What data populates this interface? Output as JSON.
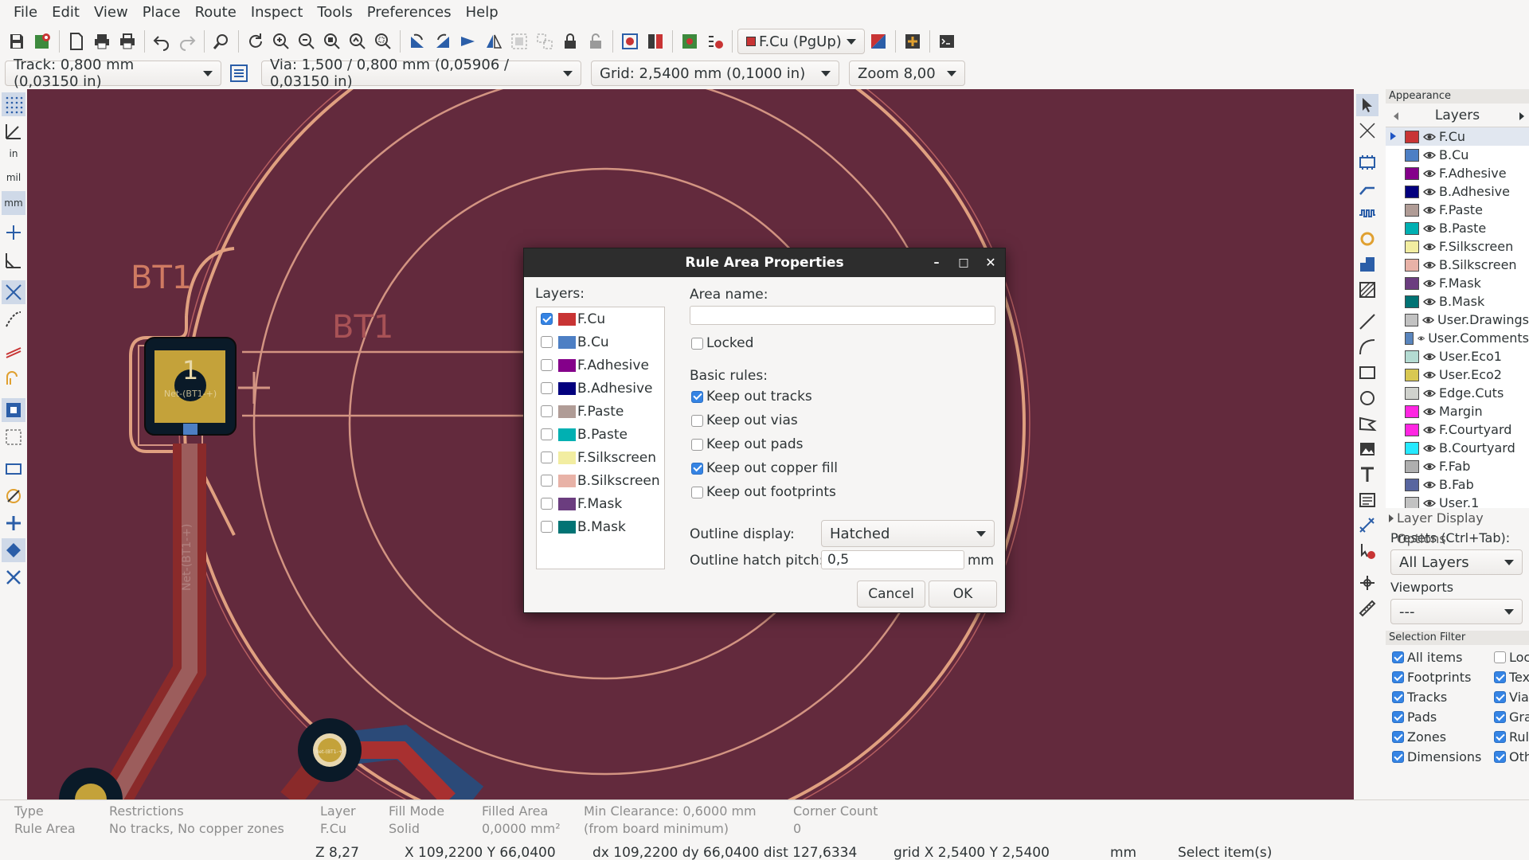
{
  "menu": [
    "File",
    "Edit",
    "View",
    "Place",
    "Route",
    "Inspect",
    "Tools",
    "Preferences",
    "Help"
  ],
  "toolbar": {
    "active_layer": "F.Cu (PgUp)",
    "active_layer_color": "#c83434",
    "track": "Track: 0,800 mm (0,03150 in)",
    "via": "Via: 1,500 / 0,800 mm (0,05906 / 0,03150 in)",
    "grid": "Grid: 2,5400 mm (0,1000 in)",
    "zoom": "Zoom 8,00"
  },
  "left_toolbar": {
    "mil_label": "mil",
    "mm_label": "mm",
    "in_label": "in"
  },
  "canvas": {
    "ref_outer": "BT1",
    "ref_inner": "BT1",
    "pad_number": "1",
    "pad_net": "Net-(BT1-+)",
    "track_net": "Net-(BT1-+)",
    "via_net": "Net-(BT1-+)",
    "board_color": "#632a3d"
  },
  "appearance": {
    "title": "Appearance",
    "tab": "Layers",
    "layers": [
      {
        "name": "F.Cu",
        "color": "#c83434",
        "selected": true
      },
      {
        "name": "B.Cu",
        "color": "#4d7fc4"
      },
      {
        "name": "F.Adhesive",
        "color": "#84008a"
      },
      {
        "name": "B.Adhesive",
        "color": "#03007e"
      },
      {
        "name": "F.Paste",
        "color": "#b09c96"
      },
      {
        "name": "B.Paste",
        "color": "#00b0b2"
      },
      {
        "name": "F.Silkscreen",
        "color": "#f2eda1"
      },
      {
        "name": "B.Silkscreen",
        "color": "#e8b2a7"
      },
      {
        "name": "F.Mask",
        "color": "#6b3d7f"
      },
      {
        "name": "B.Mask",
        "color": "#027374"
      },
      {
        "name": "User.Drawings",
        "color": "#c2c2c2"
      },
      {
        "name": "User.Comments",
        "color": "#5985bd"
      },
      {
        "name": "User.Eco1",
        "color": "#b4dbd2"
      },
      {
        "name": "User.Eco2",
        "color": "#d8c852"
      },
      {
        "name": "Edge.Cuts",
        "color": "#d0d2cd"
      },
      {
        "name": "Margin",
        "color": "#ff26e2"
      },
      {
        "name": "F.Courtyard",
        "color": "#ff26e2"
      },
      {
        "name": "B.Courtyard",
        "color": "#26e9ff"
      },
      {
        "name": "F.Fab",
        "color": "#afafaf"
      },
      {
        "name": "B.Fab",
        "color": "#58659f"
      },
      {
        "name": "User.1",
        "color": "#c2c2c2"
      }
    ],
    "layer_display_options": "Layer Display Options",
    "presets_label": "Presets (Ctrl+Tab):",
    "presets_value": "All Layers",
    "viewports_label": "Viewports (Shift+Tab):",
    "viewports_value": "---",
    "selection_filter_title": "Selection Filter",
    "filter_left": [
      "All items",
      "Footprints",
      "Tracks",
      "Pads",
      "Zones",
      "Dimensions"
    ],
    "filter_right": [
      "Locked items",
      "Text",
      "Vias",
      "Graphics",
      "Rule Areas",
      "Other items"
    ],
    "filter_right_checked": [
      false,
      true,
      true,
      true,
      true,
      true
    ]
  },
  "status": {
    "type_header": "Type",
    "type_value": "Rule Area",
    "restrictions_header": "Restrictions",
    "restrictions_value": "No tracks, No copper zones",
    "layer_header": "Layer",
    "layer_value": "F.Cu",
    "fill_header": "Fill Mode",
    "fill_value": "Solid",
    "filled_header": "Filled Area",
    "filled_value": "0,0000 mm²",
    "clearance_header": "Min Clearance: 0,6000 mm",
    "clearance_value": "(from board minimum)",
    "corner_header": "Corner Count",
    "corner_value": "0",
    "zoom": "Z 8,27",
    "xy": "X 109,2200  Y 66,0400",
    "delta": "dx 109,2200  dy 66,0400  dist 127,6334",
    "grid": "grid X 2,5400  Y 2,5400",
    "units": "mm",
    "mode": "Select item(s)"
  },
  "dialog": {
    "title": "Rule Area Properties",
    "layers_label": "Layers:",
    "layers": [
      {
        "name": "F.Cu",
        "color": "#c83434",
        "checked": true
      },
      {
        "name": "B.Cu",
        "color": "#4d7fc4",
        "checked": false
      },
      {
        "name": "F.Adhesive",
        "color": "#84008a",
        "checked": false
      },
      {
        "name": "B.Adhesive",
        "color": "#03007e",
        "checked": false
      },
      {
        "name": "F.Paste",
        "color": "#b09c96",
        "checked": false
      },
      {
        "name": "B.Paste",
        "color": "#00b0b2",
        "checked": false
      },
      {
        "name": "F.Silkscreen",
        "color": "#f2eda1",
        "checked": false
      },
      {
        "name": "B.Silkscreen",
        "color": "#e8b2a7",
        "checked": false
      },
      {
        "name": "F.Mask",
        "color": "#6b3d7f",
        "checked": false
      },
      {
        "name": "B.Mask",
        "color": "#027374",
        "checked": false
      }
    ],
    "area_name_label": "Area name:",
    "area_name_value": "",
    "locked_label": "Locked",
    "locked": false,
    "basic_rules_label": "Basic rules:",
    "rules": [
      {
        "label": "Keep out tracks",
        "checked": true
      },
      {
        "label": "Keep out vias",
        "checked": false
      },
      {
        "label": "Keep out pads",
        "checked": false
      },
      {
        "label": "Keep out copper fill",
        "checked": true
      },
      {
        "label": "Keep out footprints",
        "checked": false
      }
    ],
    "outline_display_label": "Outline display:",
    "outline_display_value": "Hatched",
    "hatch_pitch_label": "Outline hatch pitch:",
    "hatch_pitch_value": "0,5",
    "hatch_pitch_unit": "mm",
    "cancel_label": "Cancel",
    "ok_label": "OK"
  }
}
